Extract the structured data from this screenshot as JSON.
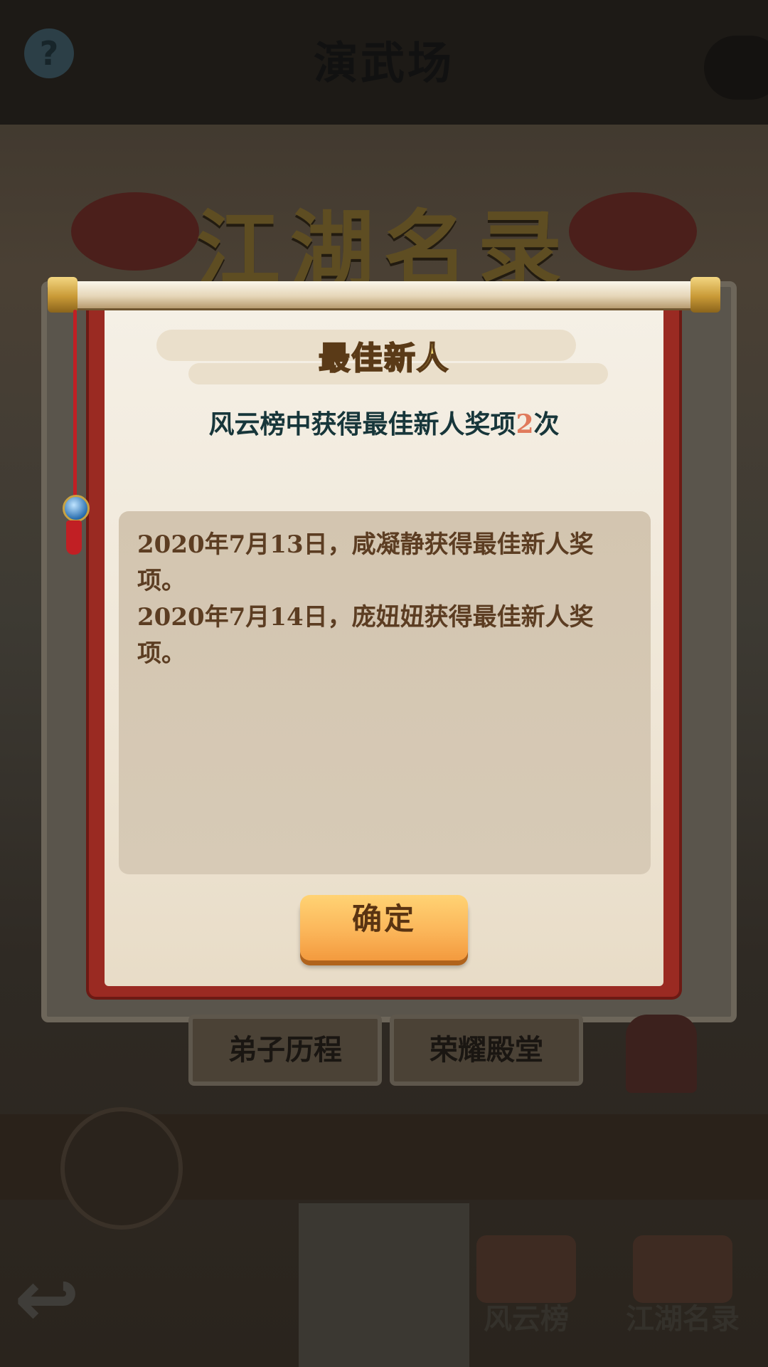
{
  "background": {
    "header_title": "演武场",
    "help_label": "?",
    "banner_title": "江湖名录",
    "tabs": [
      "弟子历程",
      "荣耀殿堂"
    ],
    "bottom_nav": [
      "风云榜",
      "江湖名录"
    ],
    "back_icon": "back-arrow-icon"
  },
  "dialog": {
    "title": "最佳新人",
    "summary_prefix": "风云榜中获得最佳新人奖项",
    "summary_count": "2",
    "summary_suffix": "次",
    "records": [
      "2020年7月13日，咸凝静获得最佳新人奖项。",
      "2020年7月14日，庞妞妞获得最佳新人奖项。"
    ],
    "confirm_label": "确定"
  },
  "colors": {
    "scroll_border": "#9a2a22",
    "title_gold": "#f7df75",
    "summary_text": "#17363a",
    "count_highlight": "#e07a5c",
    "record_text": "#5c3d22",
    "button_orange": "#fbb65a"
  }
}
